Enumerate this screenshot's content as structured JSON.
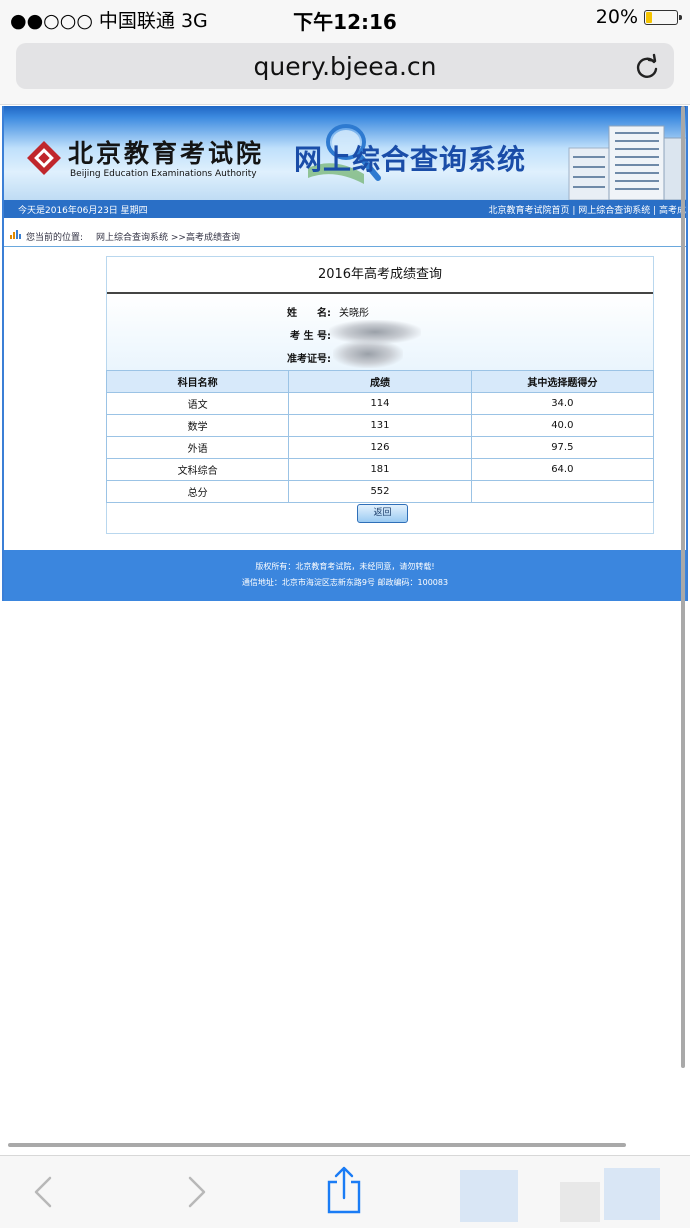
{
  "status_bar": {
    "carrier": "●●○○○ 中国联通  3G",
    "time": "下午12:16",
    "battery_text": "20%",
    "battery_level": 0.2
  },
  "browser": {
    "url": "query.bjeea.cn",
    "reload_icon": "reload-icon"
  },
  "site": {
    "logo": {
      "cn": "北京教育考试院",
      "en": "Beijing Education Examinations Authority"
    },
    "system_title": "网上综合查询系统",
    "nav": {
      "date": "今天是2016年06月23日 星期四",
      "links": "北京教育考试院首页 | 网上综合查询系统 | 高考成"
    },
    "breadcrumb": {
      "label": "您当前的位置:",
      "path": "网上综合查询系统 >>高考成绩查询"
    },
    "panel": {
      "title": "2016年高考成绩查询",
      "info": {
        "name_label": "姓　　名:",
        "name_value": "关晓彤",
        "exam_no_label": "考 生 号:",
        "ticket_label": "准考证号:"
      },
      "table": {
        "headers": [
          "科目名称",
          "成绩",
          "其中选择题得分"
        ],
        "rows": [
          [
            "语文",
            "114",
            "34.0"
          ],
          [
            "数学",
            "131",
            "40.0"
          ],
          [
            "外语",
            "126",
            "97.5"
          ],
          [
            "文科综合",
            "181",
            "64.0"
          ],
          [
            "总分",
            "552",
            ""
          ]
        ]
      },
      "back_button": "返回"
    },
    "footer": {
      "line1": "版权所有：北京教育考试院，未经同意，请勿转载!",
      "line2": "通信地址：北京市海淀区志新东路9号 邮政编码：100083"
    }
  },
  "toolbar": {
    "back_icon": "chevron-left-icon",
    "forward_icon": "chevron-right-icon",
    "share_icon": "share-icon"
  },
  "colors": {
    "banner_blue": "#2a6fc6",
    "footer_blue": "#3b86de",
    "battery_yellow": "#f5c400"
  }
}
